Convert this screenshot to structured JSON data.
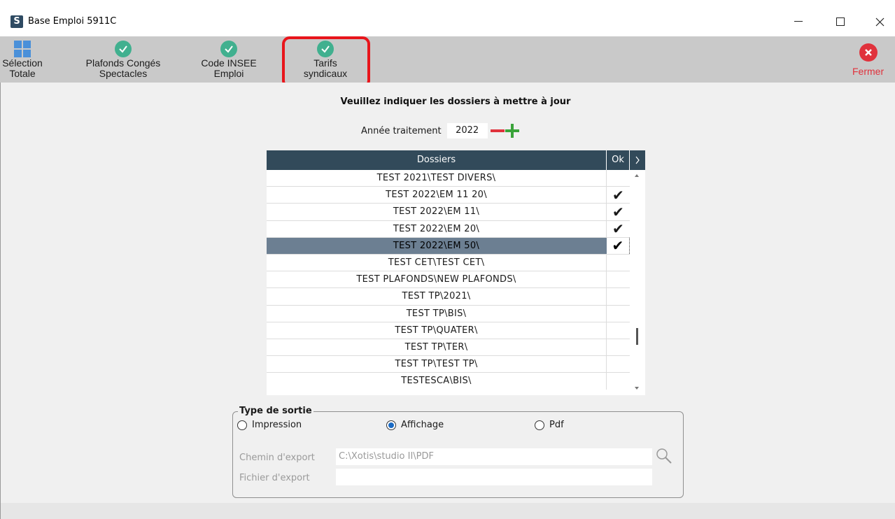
{
  "window": {
    "app_letter": "S",
    "title": "Base Emploi 5911C"
  },
  "toolbar": {
    "selection_line1": "Sélection",
    "selection_line2": "Totale",
    "plafonds_line1": "Plafonds Congés",
    "plafonds_line2": "Spectacles",
    "code_line1": "Code INSEE",
    "code_line2": "Emploi",
    "tarifs_line1": "Tarifs",
    "tarifs_line2": "syndicaux",
    "fermer": "Fermer"
  },
  "main": {
    "heading": "Veuillez indiquer les dossiers à mettre à jour",
    "year_label": "Année traitement",
    "year_value": "2022"
  },
  "grid": {
    "col_dossiers": "Dossiers",
    "col_ok": "Ok",
    "rows": [
      {
        "name": "TEST 2021\\TEST DIVERS\\",
        "ok": ""
      },
      {
        "name": "TEST 2022\\EM 11 20\\",
        "ok": "✔"
      },
      {
        "name": "TEST 2022\\EM 11\\",
        "ok": "✔"
      },
      {
        "name": "TEST 2022\\EM 20\\",
        "ok": "✔"
      },
      {
        "name": "TEST 2022\\EM 50\\",
        "ok": "✔"
      },
      {
        "name": "TEST CET\\TEST CET\\",
        "ok": ""
      },
      {
        "name": "TEST PLAFONDS\\NEW PLAFONDS\\",
        "ok": ""
      },
      {
        "name": "TEST TP\\2021\\",
        "ok": ""
      },
      {
        "name": "TEST TP\\BIS\\",
        "ok": ""
      },
      {
        "name": "TEST TP\\QUATER\\",
        "ok": ""
      },
      {
        "name": "TEST TP\\TER\\",
        "ok": ""
      },
      {
        "name": "TEST TP\\TEST TP\\",
        "ok": ""
      },
      {
        "name": "TESTESCA\\BIS\\",
        "ok": ""
      }
    ]
  },
  "sortie": {
    "legend": "Type de sortie",
    "impression": "Impression",
    "affichage": "Affichage",
    "pdf": "Pdf",
    "selected": "Affichage",
    "chemin_label": "Chemin d'export",
    "chemin_value": "C:\\Xotis\\studio II\\PDF",
    "fichier_label": "Fichier d'export",
    "fichier_value": ""
  },
  "colors": {
    "highlight": "#e8151b",
    "check": "#41b08f",
    "close": "#e0323c",
    "grid_header": "#324a5a",
    "selected_row": "#6c7f92"
  }
}
